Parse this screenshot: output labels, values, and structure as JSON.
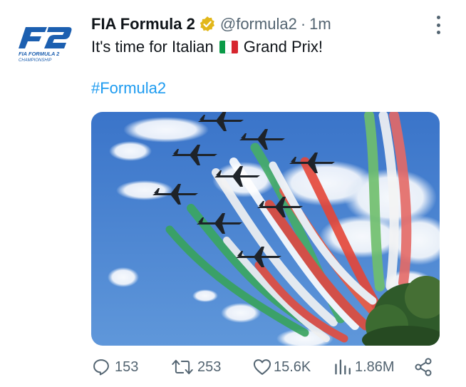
{
  "tweet": {
    "display_name": "FIA Formula 2",
    "handle": "@formula2",
    "separator": "·",
    "time": "1m",
    "text_before_flag": "It's time for Italian",
    "text_after_flag": "Grand Prix!",
    "hashtag": "#Formula2",
    "avatar_logo": {
      "mark": "F2",
      "line1": "FIA FORMULA 2",
      "line2": "CHAMPIONSHIP",
      "color": "#1c5fb0"
    },
    "flag_colors": [
      "#0a9a47",
      "#ffffff",
      "#d6252e"
    ],
    "colors": {
      "text": "#0f1419",
      "secondary": "#536471",
      "link": "#1d9bf0",
      "verified_gold": "#e2b719"
    }
  },
  "actions": {
    "reply": {
      "icon": "reply-icon",
      "count": "153"
    },
    "retweet": {
      "icon": "retweet-icon",
      "count": "253"
    },
    "like": {
      "icon": "heart-icon",
      "count": "15.6K"
    },
    "views": {
      "icon": "views-chart-icon",
      "count": "1.86M"
    },
    "share": {
      "icon": "share-icon"
    }
  }
}
